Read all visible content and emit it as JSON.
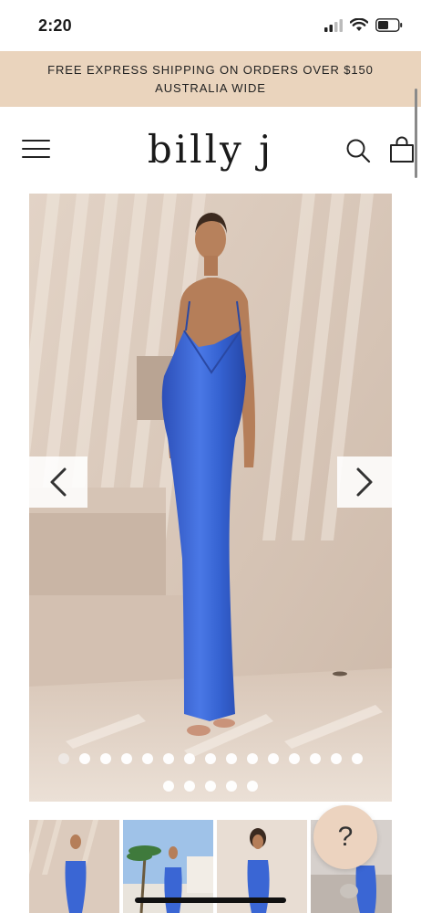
{
  "status_bar": {
    "time": "2:20"
  },
  "banner": {
    "line1": "FREE EXPRESS SHIPPING ON ORDERS OVER $150",
    "line2": "AUSTRALIA WIDE",
    "background": "#ead4bd"
  },
  "header": {
    "logo": "billy j",
    "menu_icon": "hamburger-icon",
    "search_icon": "search-icon",
    "cart_icon": "shopping-bag-icon"
  },
  "gallery": {
    "product_color": "#3a66d4",
    "prev_icon": "chevron-left-icon",
    "next_icon": "chevron-right-icon",
    "dots_row1": 15,
    "dots_row2": 5,
    "active_dot": 0
  },
  "thumbnails": {
    "count": 4
  },
  "help": {
    "label": "?"
  }
}
